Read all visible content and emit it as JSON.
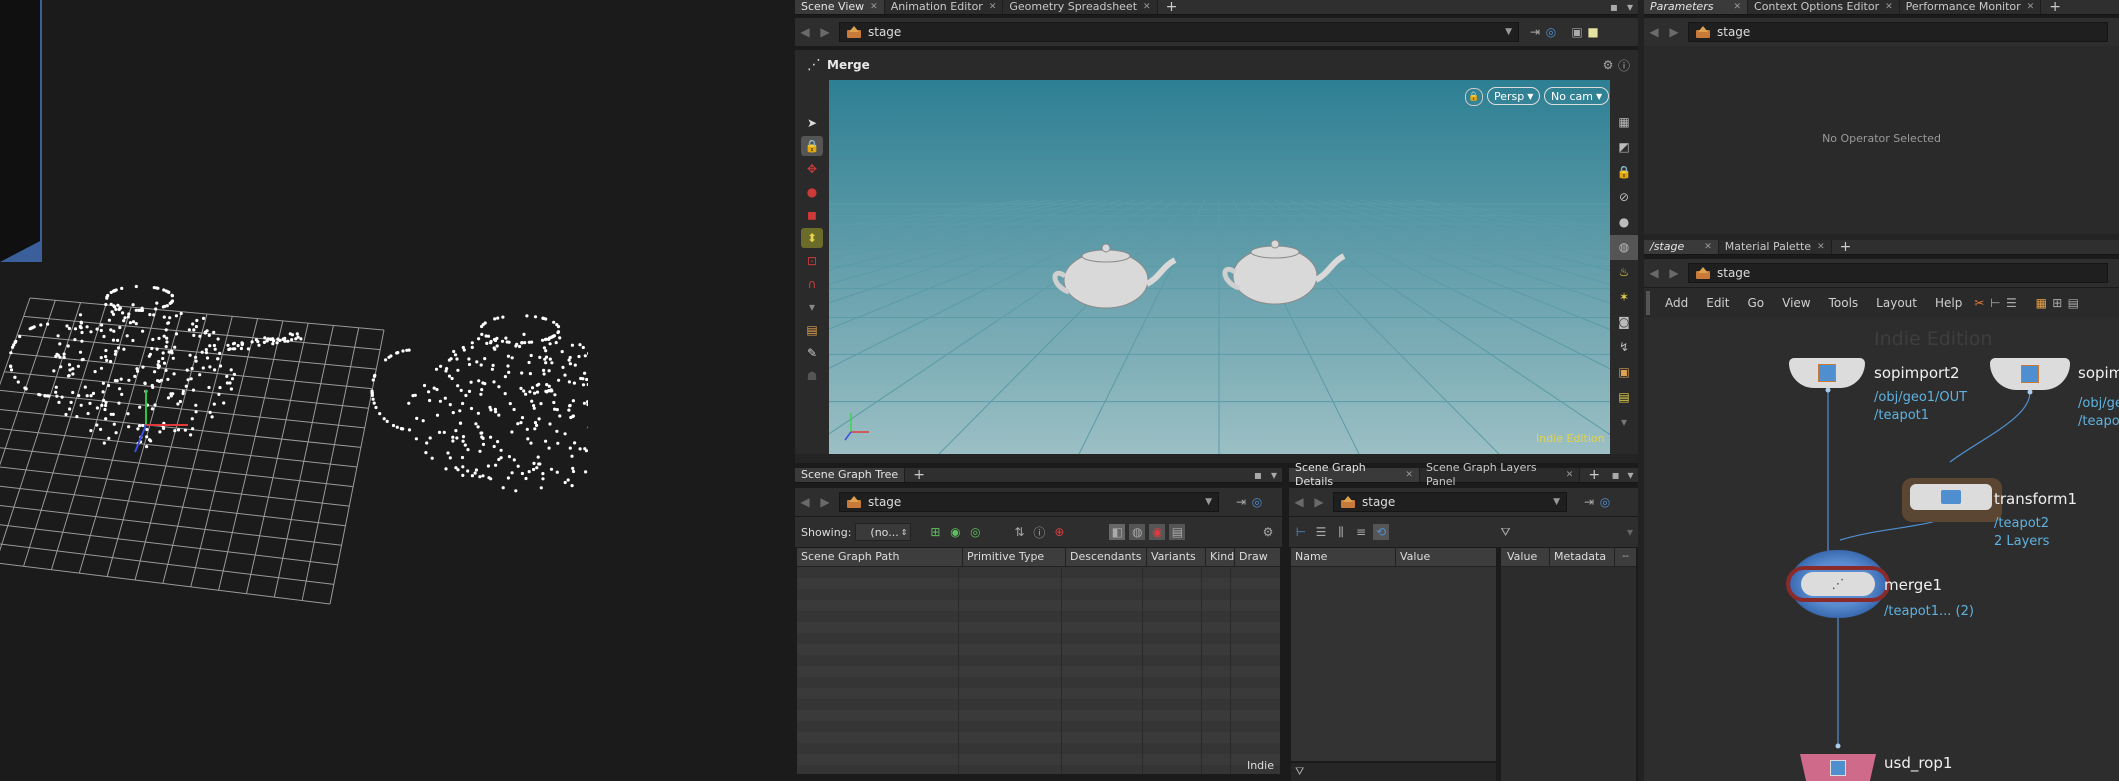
{
  "scene_view_tabs": [
    {
      "label": "Scene View",
      "active": true
    },
    {
      "label": "Animation Editor",
      "active": false
    },
    {
      "label": "Geometry Spreadsheet",
      "active": false
    }
  ],
  "right_tabs_top": [
    {
      "label": "Parameters",
      "active": true
    },
    {
      "label": "Context Options Editor",
      "active": false
    },
    {
      "label": "Performance Monitor",
      "active": false
    }
  ],
  "network_tabs": [
    {
      "label": "/stage",
      "active": true
    },
    {
      "label": "Material Palette",
      "active": false
    }
  ],
  "stage_path": "stage",
  "viewer": {
    "node_title": "Merge",
    "persp_label": "Persp",
    "cam_label": "No cam",
    "edition_badge": "Indie Edition"
  },
  "parameters": {
    "empty_message": "No Operator Selected"
  },
  "scene_graph_tree": {
    "tab_label": "Scene Graph Tree",
    "showing_label": "Showing:",
    "showing_value": "(no...",
    "columns": [
      "Scene Graph Path",
      "Primitive Type",
      "Descendants",
      "Variants",
      "Kind",
      "Draw Mode"
    ],
    "footer": "Indie"
  },
  "scene_graph_details": {
    "tabs": [
      {
        "label": "Scene Graph Details",
        "active": true
      },
      {
        "label": "Scene Graph Layers Panel",
        "active": false
      }
    ],
    "columns": [
      "Name",
      "Value"
    ],
    "side_columns": [
      "Value",
      "Metadata"
    ]
  },
  "network_menu": [
    "Add",
    "Edit",
    "Go",
    "View",
    "Tools",
    "Layout",
    "Help"
  ],
  "network": {
    "watermark": "Indie Edition",
    "nodes": [
      {
        "name": "sopimport2",
        "sub1": "/obj/geo1/OUT",
        "sub2": "/teapot1"
      },
      {
        "name": "sopim",
        "sub1": "/obj/ge",
        "sub2": "/teapot"
      },
      {
        "name": "transform1",
        "sub1": "/teapot2",
        "sub2": "2 Layers"
      },
      {
        "name": "merge1",
        "sub1": "/teapot1... (2)"
      },
      {
        "name": "usd_rop1"
      }
    ]
  },
  "colors": {
    "accent_blue": "#4f8fd0",
    "node_text_cyan": "#5fb2e0",
    "viewport_top": "#2d7f93",
    "viewport_bottom": "#9bbfc4",
    "indie_yellow": "#e6d34a"
  }
}
